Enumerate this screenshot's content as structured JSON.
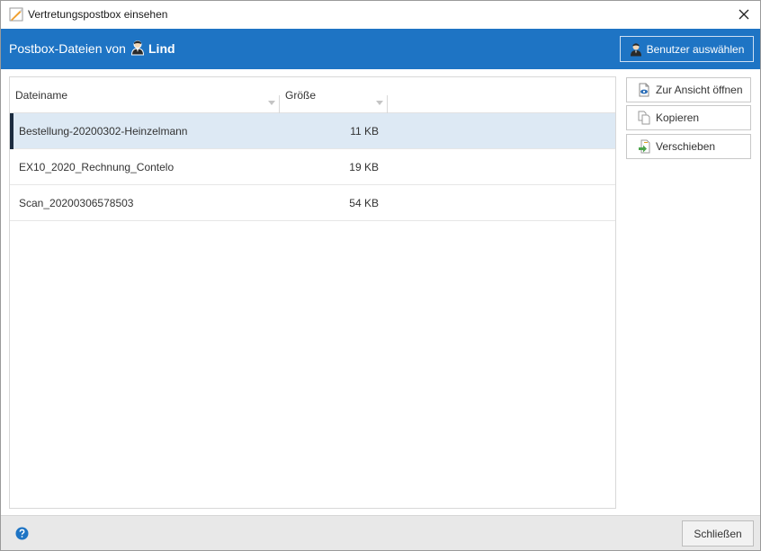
{
  "window": {
    "title": "Vertretungspostbox einsehen"
  },
  "header": {
    "label": "Postbox-Dateien von",
    "user": "Lind",
    "select_user_label": "Benutzer auswählen",
    "background_color": "#1e74c4"
  },
  "table": {
    "columns": [
      "Dateiname",
      "Größe"
    ],
    "rows": [
      {
        "name": "Bestellung-20200302-Heinzelmann",
        "size": "11 KB",
        "selected": true
      },
      {
        "name": "EX10_2020_Rechnung_Contelo",
        "size": "19 KB",
        "selected": false
      },
      {
        "name": "Scan_20200306578503",
        "size": "54 KB",
        "selected": false
      }
    ]
  },
  "actions": {
    "open_label": "Zur Ansicht öffnen",
    "copy_label": "Kopieren",
    "move_label": "Verschieben"
  },
  "footer": {
    "close_label": "Schließen"
  },
  "icons": {
    "app": "document-pencil-icon",
    "close": "close-icon",
    "user": "user-icon",
    "open": "document-eye-icon",
    "copy": "copy-icon",
    "move": "move-icon",
    "help": "help-icon",
    "sort": "sort-arrow-icon"
  }
}
